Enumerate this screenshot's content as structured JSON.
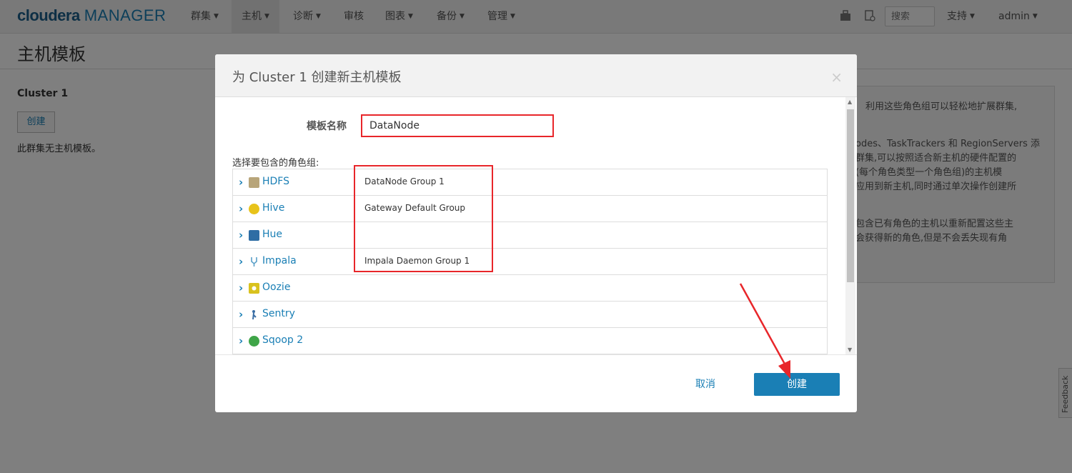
{
  "navbar": {
    "brand_part1": "cloudera",
    "brand_part2": "MANAGER",
    "items": [
      {
        "label": "群集"
      },
      {
        "label": "主机"
      },
      {
        "label": "诊断"
      },
      {
        "label": "审核"
      },
      {
        "label": "图表"
      },
      {
        "label": "备份"
      },
      {
        "label": "管理"
      }
    ],
    "search_placeholder": "搜索",
    "support_label": "支持",
    "user_label": "admin"
  },
  "page": {
    "title": "主机模板",
    "cluster_heading": "Cluster 1",
    "create_label": "创建",
    "no_templates_text": "此群集无主机模板。",
    "help_lines": [
      "利用这些角色组可以轻松地扩展群集,",
      "odes、TaskTrackers 和 RegionServers 添",
      "群集,可以按照适合新主机的硬件配置的",
      "(每个角色类型一个角色组)的主机模",
      "应用到新主机,同时通过单次操作创建所",
      "包含已有角色的主机以重新配置这些主",
      "会获得新的角色,但是不会丢失现有角"
    ],
    "feedback_label": "Feedback"
  },
  "modal": {
    "title": "为 Cluster 1 创建新主机模板",
    "close_symbol": "×",
    "template_name_label": "模板名称",
    "template_name_value": "DataNode",
    "role_groups_label": "选择要包含的角色组:",
    "services": [
      {
        "name": "HDFS",
        "role_group": "DataNode Group 1",
        "icon": "hdfs-icon",
        "color": "#b8a57a"
      },
      {
        "name": "Hive",
        "role_group": "Gateway Default Group",
        "icon": "hive-icon",
        "color": "#e8c31a"
      },
      {
        "name": "Hue",
        "role_group": "",
        "icon": "hue-icon",
        "color": "#2e6da4"
      },
      {
        "name": "Impala",
        "role_group": "Impala Daemon Group 1",
        "icon": "impala-icon",
        "color": "#5aa0c8"
      },
      {
        "name": "Oozie",
        "role_group": "",
        "icon": "oozie-icon",
        "color": "#d9c21e"
      },
      {
        "name": "Sentry",
        "role_group": "",
        "icon": "sentry-icon",
        "color": "#3a6ea5"
      },
      {
        "name": "Sqoop 2",
        "role_group": "",
        "icon": "sqoop-icon",
        "color": "#3fa548"
      }
    ],
    "cancel_label": "取消",
    "create_label": "创建"
  },
  "colors": {
    "accent": "#1a7fb5",
    "highlight_box": "#e8262a"
  }
}
